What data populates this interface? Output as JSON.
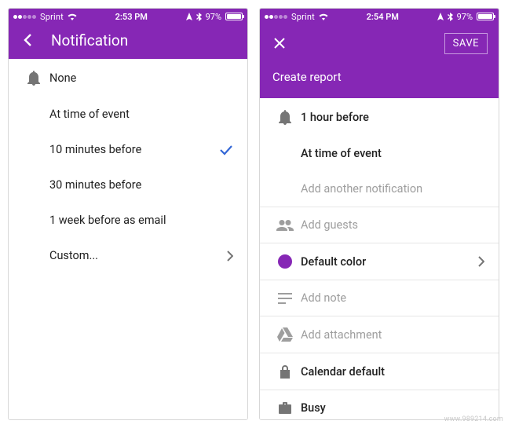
{
  "left": {
    "statusbar": {
      "carrier": "Sprint",
      "time": "2:53 PM",
      "battery": "97%"
    },
    "nav": {
      "title": "Notification"
    },
    "options": [
      {
        "label": "None",
        "selected": false,
        "hasChevron": false
      },
      {
        "label": "At time of event",
        "selected": false,
        "hasChevron": false
      },
      {
        "label": "10 minutes before",
        "selected": true,
        "hasChevron": false
      },
      {
        "label": "30 minutes before",
        "selected": false,
        "hasChevron": false
      },
      {
        "label": "1 week before as email",
        "selected": false,
        "hasChevron": false
      },
      {
        "label": "Custom...",
        "selected": false,
        "hasChevron": true
      }
    ]
  },
  "right": {
    "statusbar": {
      "carrier": "Sprint",
      "time": "2:54 PM",
      "battery": "97%"
    },
    "nav": {
      "save": "SAVE",
      "subtitle": "Create report"
    },
    "rows": {
      "notif1": "1 hour before",
      "notif2": "At time of event",
      "addNotif": "Add another notification",
      "addGuests": "Add guests",
      "defaultColor": "Default color",
      "addNote": "Add note",
      "addAttachment": "Add attachment",
      "calendarDefault": "Calendar default",
      "busy": "Busy"
    },
    "accentColor": "#8627b5"
  },
  "watermark": "www.989214.com"
}
